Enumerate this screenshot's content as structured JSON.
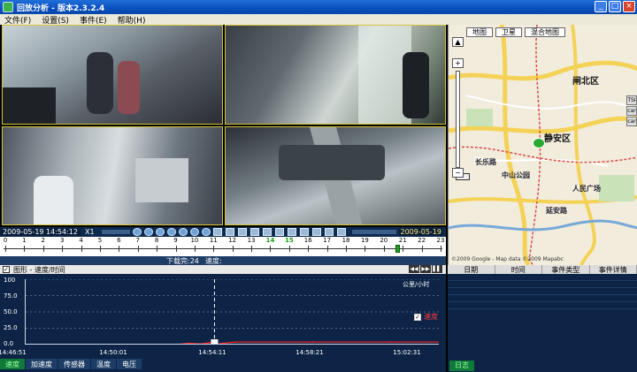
{
  "window": {
    "title": "回放分析 - 版本2.3.2.4",
    "minimize": "_",
    "maximize": "□",
    "close": "×"
  },
  "menu": [
    "文件(F)",
    "设置(S)",
    "事件(E)",
    "帮助(H)"
  ],
  "map": {
    "tabs": [
      "地图",
      "卫星",
      "混合地图"
    ],
    "zoom_in": "+",
    "zoom_out": "−",
    "labels": {
      "district_north": "闸北区",
      "district_jingan": "静安区",
      "road_changle": "长乐路",
      "park_zhongshan": "中山公园",
      "people_square": "人民广场",
      "yanan": "延安路"
    },
    "credit": "©2009 Google - Map data ©2009 Mapabc",
    "side_icons": [
      "TSI",
      "car",
      "car"
    ]
  },
  "playback": {
    "timestamp": "2009-05-19 14:54:12",
    "speed": "X1",
    "date": "2009-05-19",
    "timeline_hours": [
      "0",
      "1",
      "2",
      "3",
      "4",
      "5",
      "6",
      "7",
      "8",
      "9",
      "10",
      "11",
      "12",
      "13",
      "14",
      "15",
      "16",
      "17",
      "18",
      "19",
      "20",
      "21",
      "22",
      "23"
    ],
    "highlight_hours": [
      "14",
      "15"
    ],
    "status": [
      "下载完:24",
      "速度:"
    ]
  },
  "chart_panel": {
    "title": "图形 - 速度/时间",
    "unit": "公里/小时",
    "legend": "速度"
  },
  "chart_data": {
    "type": "line",
    "title": "",
    "xlabel": "",
    "ylabel": "公里/小时",
    "ylim": [
      0,
      100
    ],
    "y_ticks": [
      "100",
      "75.0",
      "50.0",
      "25.0",
      "0.0"
    ],
    "x_ticks": [
      "14:46:51",
      "14:50:01",
      "14:54:11",
      "14:58:21",
      "15:02:31"
    ],
    "series": [
      {
        "name": "速度",
        "color": "#ff2020",
        "x": [
          "14:52:40",
          "14:53:10",
          "14:53:40",
          "14:54:00",
          "14:54:11",
          "14:54:30",
          "14:55:00",
          "14:58:00",
          "15:01:00",
          "15:04:00"
        ],
        "values": [
          0,
          2,
          1,
          3,
          0,
          2,
          4,
          4,
          4,
          4
        ]
      }
    ],
    "cursor_x": "14:54:11",
    "grid": true,
    "legend_position": "right"
  },
  "bottom_tabs": [
    "速度",
    "加速度",
    "传感器",
    "温度",
    "电压"
  ],
  "event_table": {
    "columns": [
      "日期",
      "时间",
      "事件类型",
      "事件详情"
    ],
    "tab": "日志"
  },
  "colors": {
    "accent": "#1f6fd8",
    "panel": "#0d2446",
    "video_border": "#d4c23c",
    "active_tab": "#0f7a3a"
  }
}
